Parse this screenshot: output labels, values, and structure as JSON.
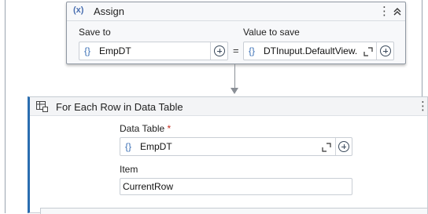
{
  "assign": {
    "icon": "(x)",
    "title": "Assign",
    "save_to_label": "Save to",
    "value_label": "Value to save",
    "save_to_value": "EmpDT",
    "value_value": "DTInuput.DefaultView.",
    "equals": "=",
    "brace": "{}"
  },
  "foreach": {
    "title": "For Each Row in Data Table",
    "data_table_label": "Data Table",
    "required_mark": "*",
    "data_table_value": "EmpDT",
    "brace": "{}",
    "item_label": "Item",
    "item_value": "CurrentRow"
  },
  "icons": {
    "assign": "variable-x-icon",
    "more": "kebab-menu-icon",
    "collapse": "double-chevron-up-icon",
    "add": "plus-circle-icon",
    "expand": "expand-editor-icon",
    "table": "data-table-icon"
  },
  "colors": {
    "accent": "#2a6db0",
    "brace": "#3a6fb5",
    "required": "#c42b1c"
  }
}
